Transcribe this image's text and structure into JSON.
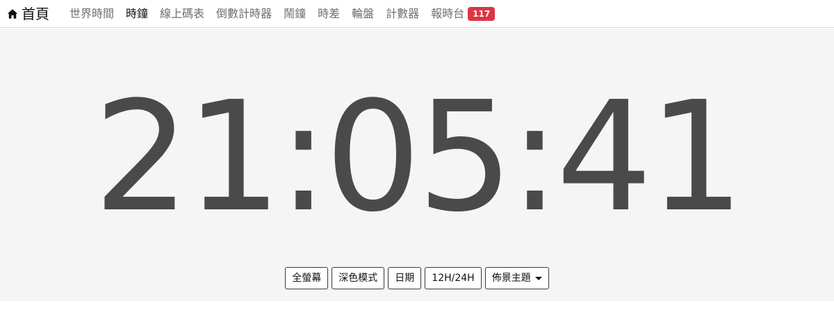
{
  "navbar": {
    "brand": {
      "label": "首頁",
      "icon": "home-icon"
    },
    "items": [
      {
        "label": "世界時間",
        "active": false
      },
      {
        "label": "時鐘",
        "active": true
      },
      {
        "label": "線上碼表",
        "active": false
      },
      {
        "label": "倒數計時器",
        "active": false
      },
      {
        "label": "鬧鐘",
        "active": false
      },
      {
        "label": "時差",
        "active": false
      },
      {
        "label": "輪盤",
        "active": false
      },
      {
        "label": "計數器",
        "active": false
      },
      {
        "label": "報時台",
        "active": false,
        "badge": "117"
      }
    ],
    "badge_color": "#dc3545"
  },
  "clock": {
    "time": "21:05:41",
    "color": "#4a4a4a",
    "background": "#f5f5f5"
  },
  "toolbar": {
    "fullscreen_label": "全螢幕",
    "dark_mode_label": "深色模式",
    "date_label": "日期",
    "format_label": "12H/24H",
    "theme_label": "佈景主題"
  }
}
